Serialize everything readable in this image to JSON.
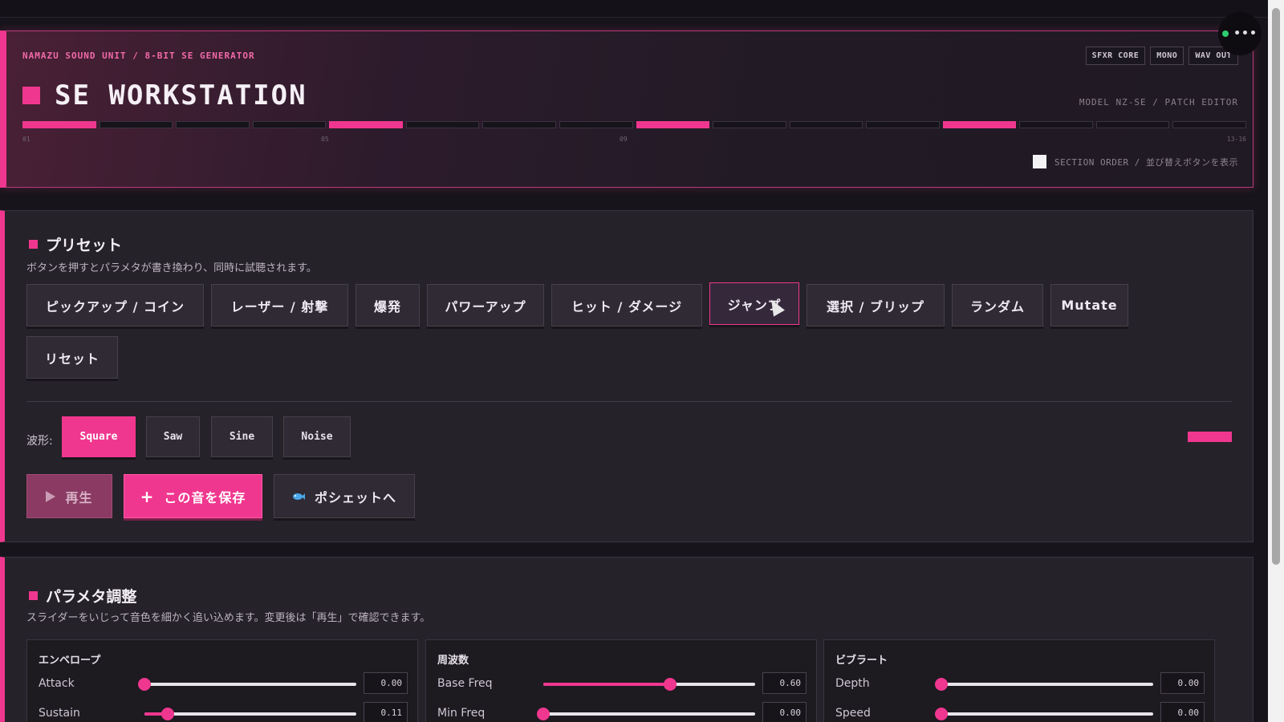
{
  "header": {
    "brand": "NAMAZU SOUND UNIT / 8-BIT SE GENERATOR",
    "title": "SE WORKSTATION",
    "tags": [
      "SFXR CORE",
      "MONO",
      "WAV OUT"
    ],
    "model": "MODEL NZ-SE / PATCH EDITOR",
    "step_labels": [
      "01",
      "05",
      "09",
      "13-16"
    ],
    "section_order_label": "SECTION ORDER / 並び替えボタンを表示",
    "steps_on": [
      1,
      5,
      9,
      13
    ]
  },
  "presets": {
    "title": "プリセット",
    "description": "ボタンを押すとパラメタが書き換わり、同時に試聴されます。",
    "buttons": [
      "ピックアップ / コイン",
      "レーザー / 射撃",
      "爆発",
      "パワーアップ",
      "ヒット / ダメージ",
      "ジャンプ",
      "選択 / ブリップ",
      "ランダム",
      "Mutate",
      "リセット"
    ],
    "active_button": "ジャンプ",
    "wave_label": "波形:",
    "waveforms": [
      "Square",
      "Saw",
      "Sine",
      "Noise"
    ],
    "selected_waveform": "Square",
    "actions": {
      "play": "再生",
      "save": "この音を保存",
      "pochette": "ポシェットへ"
    }
  },
  "params": {
    "title": "パラメタ調整",
    "description": "スライダーをいじって音色を細かく追い込めます。変更後は「再生」で確認できます。",
    "groups": [
      {
        "title": "エンベロープ",
        "rows": [
          {
            "label": "Attack",
            "value": "0.00",
            "level": 0.0
          },
          {
            "label": "Sustain",
            "value": "0.11",
            "level": 0.11
          }
        ]
      },
      {
        "title": "周波数",
        "rows": [
          {
            "label": "Base Freq",
            "value": "0.60",
            "level": 0.6
          },
          {
            "label": "Min Freq",
            "value": "0.00",
            "level": 0.0
          }
        ]
      },
      {
        "title": "ビブラート",
        "rows": [
          {
            "label": "Depth",
            "value": "0.00",
            "level": 0.0
          },
          {
            "label": "Speed",
            "value": "0.00",
            "level": 0.0
          }
        ]
      }
    ]
  }
}
